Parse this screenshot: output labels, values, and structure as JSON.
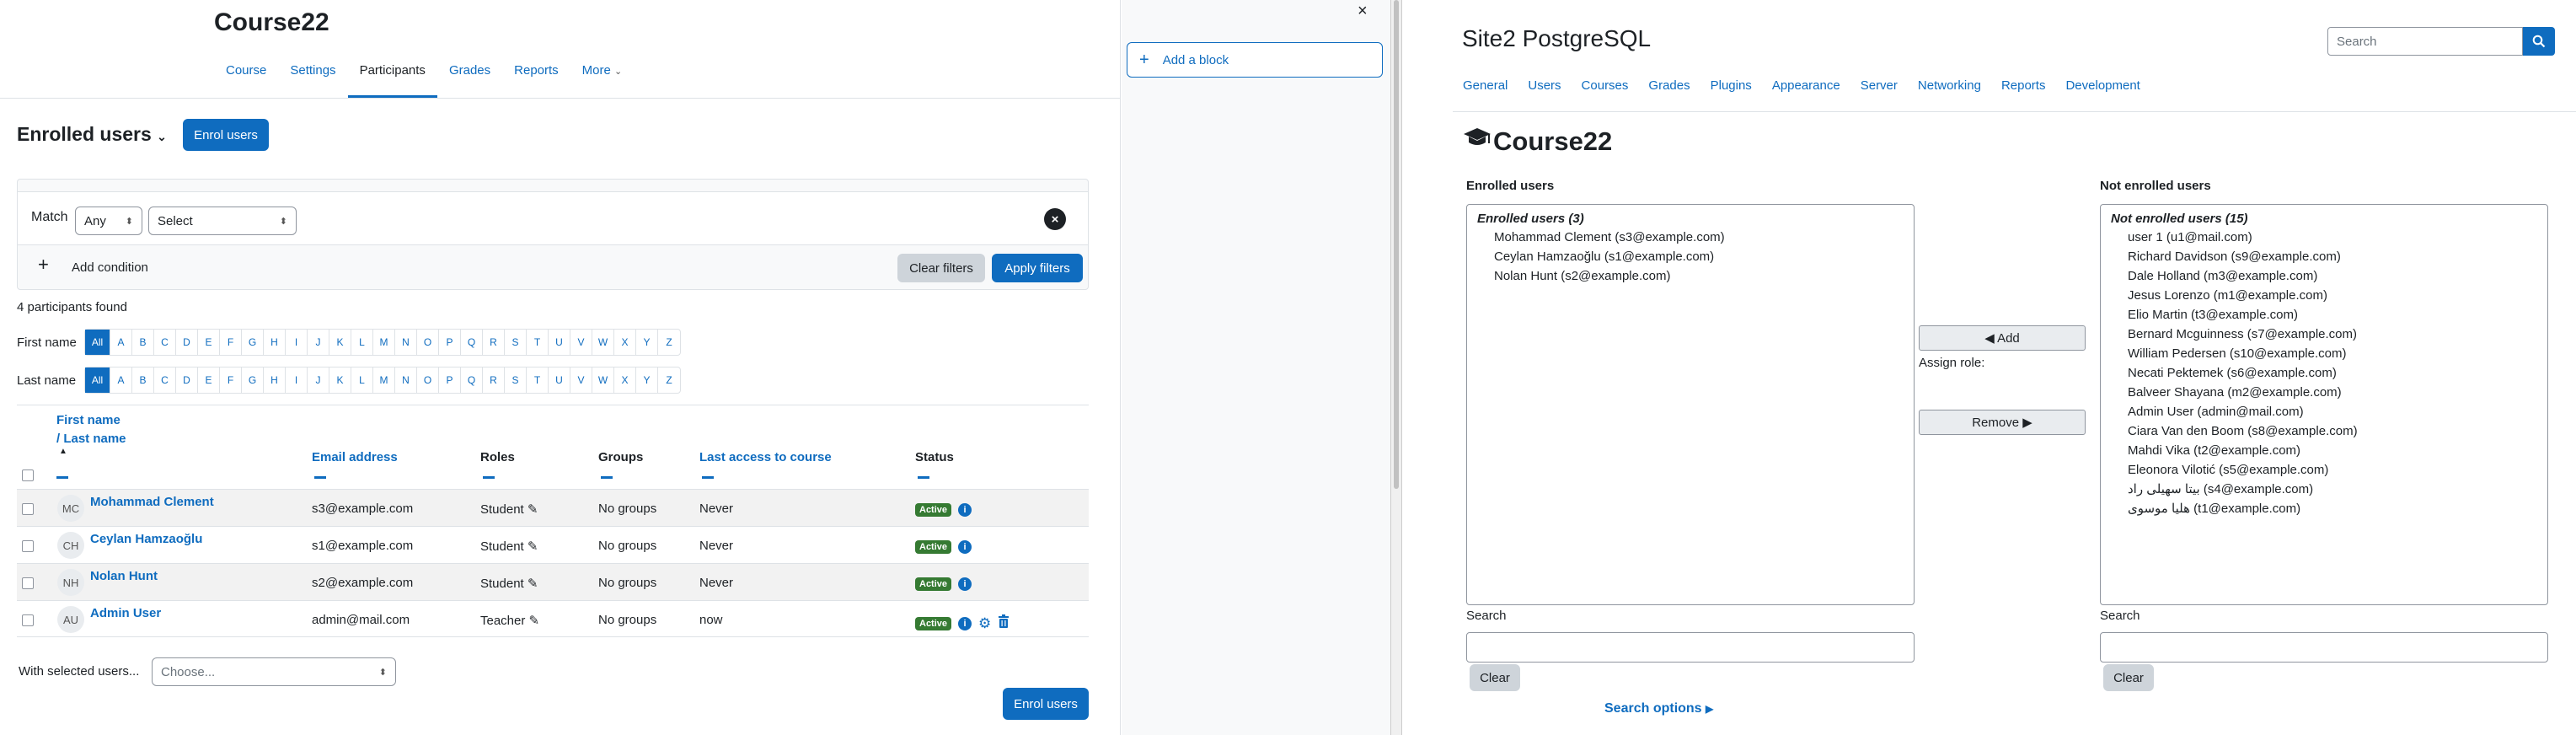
{
  "left": {
    "course_title": "Course22",
    "nav": [
      "Course",
      "Settings",
      "Participants",
      "Grades",
      "Reports",
      "More"
    ],
    "enrolled_heading": "Enrolled users",
    "enrol_button": "Enrol users",
    "filter": {
      "match_label": "Match",
      "match_value": "Any",
      "type_value": "Select",
      "add_condition": "Add condition",
      "clear_filters": "Clear filters",
      "apply_filters": "Apply filters"
    },
    "participants_found": "4 participants found",
    "first_name_label": "First name",
    "last_name_label": "Last name",
    "alphabet": [
      "All",
      "A",
      "B",
      "C",
      "D",
      "E",
      "F",
      "G",
      "H",
      "I",
      "J",
      "K",
      "L",
      "M",
      "N",
      "O",
      "P",
      "Q",
      "R",
      "S",
      "T",
      "U",
      "V",
      "W",
      "X",
      "Y",
      "Z"
    ],
    "columns": {
      "first_name": "First name",
      "last_name": "/ Last name",
      "email": "Email address",
      "roles": "Roles",
      "groups": "Groups",
      "last_access": "Last access to course",
      "status": "Status"
    },
    "rows": [
      {
        "initials": "MC",
        "name": "Mohammad Clement",
        "email": "s3@example.com",
        "role": "Student",
        "groups": "No groups",
        "access": "Never",
        "status": "Active"
      },
      {
        "initials": "CH",
        "name": "Ceylan Hamzaoğlu",
        "email": "s1@example.com",
        "role": "Student",
        "groups": "No groups",
        "access": "Never",
        "status": "Active"
      },
      {
        "initials": "NH",
        "name": "Nolan Hunt",
        "email": "s2@example.com",
        "role": "Student",
        "groups": "No groups",
        "access": "Never",
        "status": "Active"
      },
      {
        "initials": "AU",
        "name": "Admin User",
        "email": "admin@mail.com",
        "role": "Teacher",
        "groups": "No groups",
        "access": "now",
        "status": "Active"
      }
    ],
    "with_selected": "With selected users...",
    "choose": "Choose..."
  },
  "middle": {
    "add_block": "Add a block"
  },
  "right": {
    "site_title": "Site2 PostgreSQL",
    "search_placeholder": "Search",
    "nav": [
      "General",
      "Users",
      "Courses",
      "Grades",
      "Plugins",
      "Appearance",
      "Server",
      "Networking",
      "Reports",
      "Development"
    ],
    "course_heading": "Course22",
    "enrolled_title": "Enrolled users",
    "not_enrolled_title": "Not enrolled users",
    "enrolled_group": "Enrolled users (3)",
    "enrolled_list": [
      "Mohammad Clement (s3@example.com)",
      "Ceylan Hamzaoğlu (s1@example.com)",
      "Nolan Hunt (s2@example.com)"
    ],
    "not_enrolled_group": "Not enrolled users (15)",
    "not_enrolled_list": [
      "user 1 (u1@mail.com)",
      "Richard Davidson (s9@example.com)",
      "Dale Holland (m3@example.com)",
      "Jesus Lorenzo (m1@example.com)",
      "Elio Martin (t3@example.com)",
      "Bernard Mcguinness (s7@example.com)",
      "William Pedersen (s10@example.com)",
      "Necati Pektemek (s6@example.com)",
      "Balveer Shayana (m2@example.com)",
      "Admin User (admin@mail.com)",
      "Ciara Van den Boom (s8@example.com)",
      "Mahdi Vika (t2@example.com)",
      "Eleonora Vilotić (s5@example.com)",
      "بیتا سهیلی راد (s4@example.com)",
      "هلیا موسوی (t1@example.com)"
    ],
    "add_button": "◀ Add",
    "assign_role": "Assign role:",
    "remove_button": "Remove ▶",
    "search_label": "Search",
    "clear_button": "Clear",
    "search_options": "Search options"
  }
}
